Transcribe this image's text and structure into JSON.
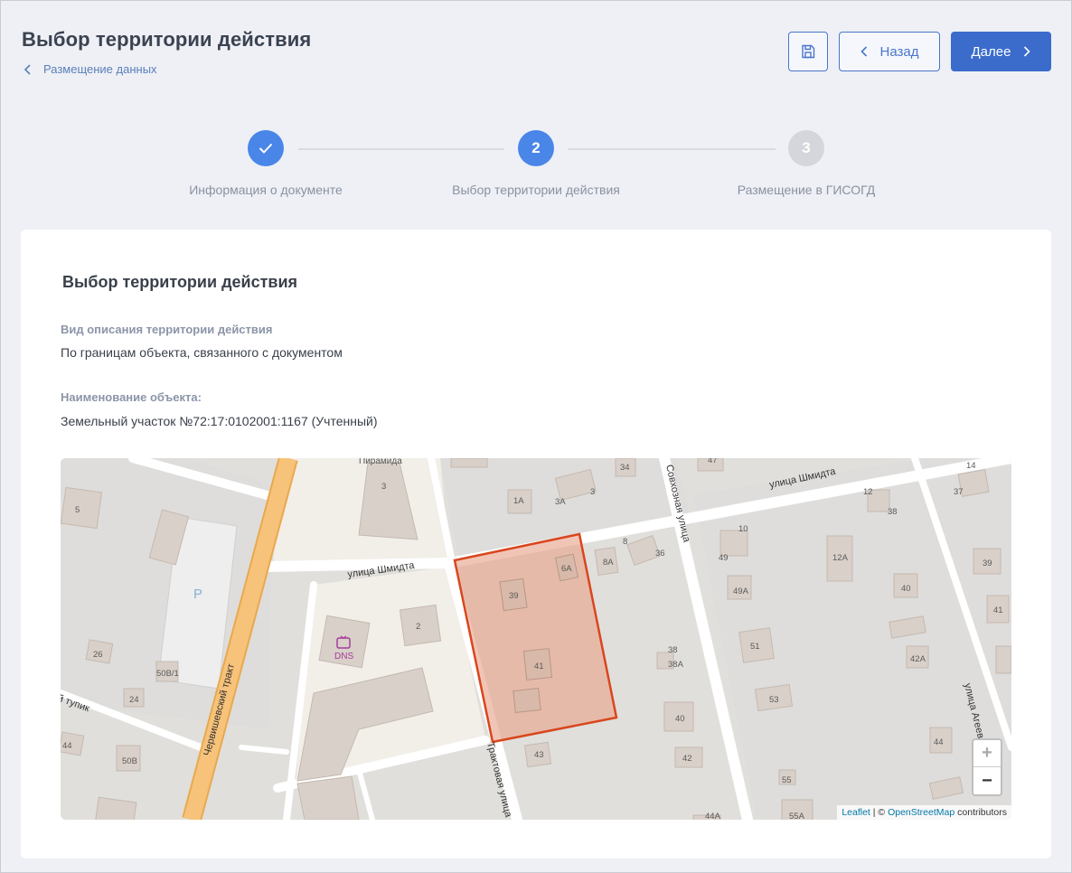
{
  "header": {
    "title": "Выбор территории действия",
    "breadcrumb": "Размещение данных",
    "back_label": "Назад",
    "next_label": "Далее"
  },
  "stepper": {
    "steps": [
      {
        "label": "Информация о документе",
        "status": "done",
        "number": ""
      },
      {
        "label": "Выбор территории действия",
        "status": "active",
        "number": "2"
      },
      {
        "label": "Размещение в ГИСОГД",
        "status": "pending",
        "number": "3"
      }
    ]
  },
  "card": {
    "title": "Выбор территории действия",
    "fields": [
      {
        "label": "Вид описания территории действия",
        "value": "По границам объекта, связанного с документом"
      },
      {
        "label": "Наименование объекта:",
        "value": "Земельный участок №72:17:0102001:1167 (Учтенный)"
      }
    ]
  },
  "map": {
    "streets": [
      "улица Шмидта",
      "улица Шмидта",
      "Червишевский тракт",
      "Трактовая улица",
      "Совхозная улица",
      "улица Агеев",
      "й тупик"
    ],
    "poi": [
      "Пирамида",
      "DNS",
      "P"
    ],
    "house_numbers": [
      "5",
      "3",
      "2",
      "26",
      "24",
      "50В/1",
      "44",
      "50В",
      "1А",
      "3А",
      "3",
      "34",
      "47",
      "39",
      "6А",
      "8А",
      "8",
      "36",
      "41",
      "43",
      "38",
      "38А",
      "40",
      "42",
      "44А",
      "10",
      "49",
      "49А",
      "51",
      "53",
      "55",
      "55А",
      "12",
      "38",
      "12А",
      "40",
      "42А",
      "44",
      "14",
      "37",
      "39",
      "41"
    ],
    "zoom_in": "+",
    "zoom_out": "−",
    "attribution": {
      "leaflet": "Leaflet",
      "sep": " | © ",
      "osm": "OpenStreetMap",
      "suffix": " contributors"
    },
    "colors": {
      "parcel_stroke": "#d9461e",
      "parcel_fill": "#e9a68f",
      "trunk_road": "#f7c27a"
    }
  },
  "colors": {
    "accent": "#3b6ccc",
    "step_done": "#4a86e8",
    "step_pending": "#d4d6db"
  }
}
